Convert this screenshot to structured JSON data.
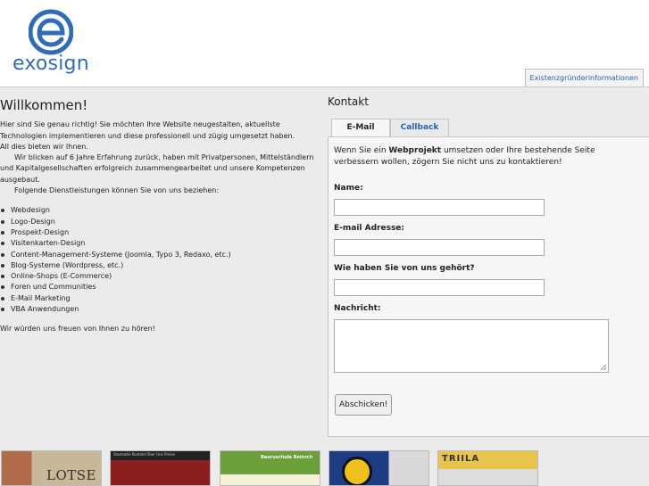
{
  "header": {
    "logo_text": "exosign",
    "top_tab": "Existenzgründerinformationen"
  },
  "welcome": {
    "title": "Willkommen!",
    "p1": "Hier sind Sie genau richtig! Sie möchten Ihre Website neugestalten, aktuellste Technologien implementieren und diese professionell und zügig umgesetzt haben.",
    "p2": "All dies bieten wir Ihnen.",
    "p3": "Wir blicken auf 6 Jahre Erfahrung zurück, haben mit Privatpersonen, Mittelständlern und Kapitalgesellschaften erfolgreich zusammengearbeitet und unsere Kompetenzen ausgebaut.",
    "p4": "Folgende Dienstleistungen können Sie von uns beziehen:",
    "services": [
      "Webdesign",
      "Logo-Design",
      "Prospekt-Design",
      "Visitenkarten-Design",
      "Content-Management-Systeme (Joomla, Typo 3, Redaxo, etc.)",
      "Blog-Systeme (Wordpress, etc.)",
      "Online-Shops (E-Commerce)",
      "Foren und Communities",
      "E-Mail Marketing",
      "VBA Anwendungen"
    ],
    "outro": "Wir würden uns freuen von Ihnen zu hören!"
  },
  "contact": {
    "title": "Kontakt",
    "tabs": [
      "E-Mail",
      "Callback"
    ],
    "intro_pre": "Wenn Sie ein ",
    "intro_bold": "Webprojekt",
    "intro_post": " umsetzen oder Ihre bestehende Seite verbessern wollen, zögern Sie nicht uns zu kontaktieren!",
    "name_label": "Name:",
    "email_label": "E-mail Adresse:",
    "source_label": "Wie haben Sie von uns gehört?",
    "message_label": "Nachricht:",
    "submit_label": "Abschicken!"
  },
  "thumbnails": {
    "t1_text": "LOTSE",
    "t2_text": "Startseite  Kontakt  Über Uns  Preise",
    "t3_text": "Bauruschule Reinrch",
    "t5_text": "TRIILA"
  },
  "colors": {
    "brand_blue": "#2f6db8",
    "link_blue": "#2a62b5"
  }
}
